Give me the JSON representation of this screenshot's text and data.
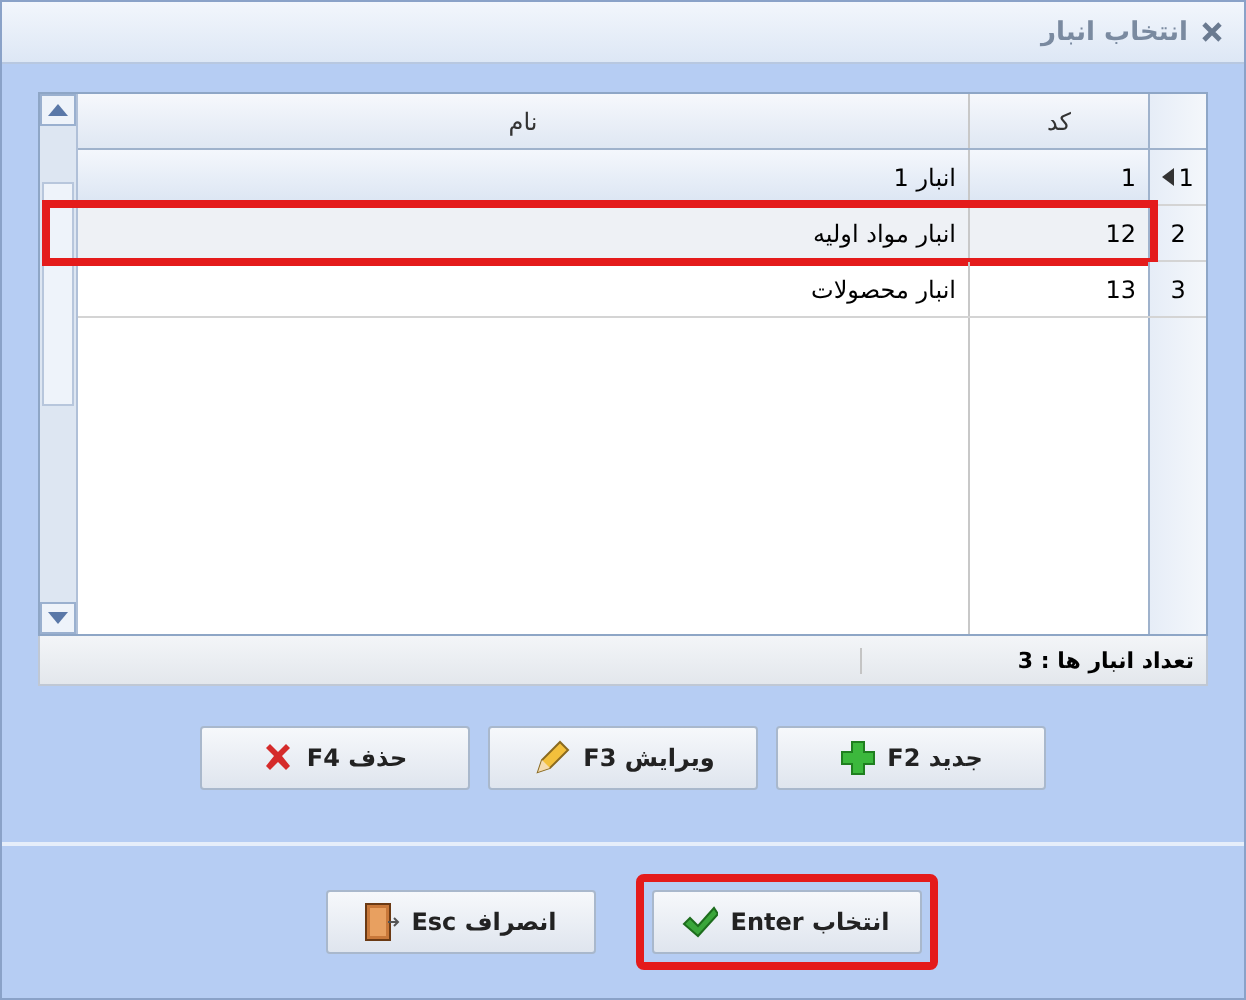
{
  "window": {
    "title": "انتخاب انبار"
  },
  "table": {
    "columns": [
      "کد",
      "نام"
    ],
    "rows": [
      {
        "number": "1",
        "code": "1",
        "name": "انبار 1",
        "selected": true,
        "highlighted": false
      },
      {
        "number": "2",
        "code": "12",
        "name": "انبار مواد اولیه",
        "selected": false,
        "highlighted": true
      },
      {
        "number": "3",
        "code": "13",
        "name": "انبار محصولات",
        "selected": false,
        "highlighted": false
      }
    ]
  },
  "status_bar": "تعداد انبار ها : 3",
  "actions": [
    {
      "kind": "add",
      "label": "جدید F2"
    },
    {
      "kind": "edit",
      "label": "ویرایش F3"
    },
    {
      "kind": "delete",
      "label": "حذف F4"
    }
  ],
  "dialog_buttons": [
    {
      "kind": "ok",
      "label": "انتخاب Enter",
      "highlighted": true
    },
    {
      "kind": "cancel",
      "label": "انصراف Esc",
      "highlighted": false
    }
  ]
}
